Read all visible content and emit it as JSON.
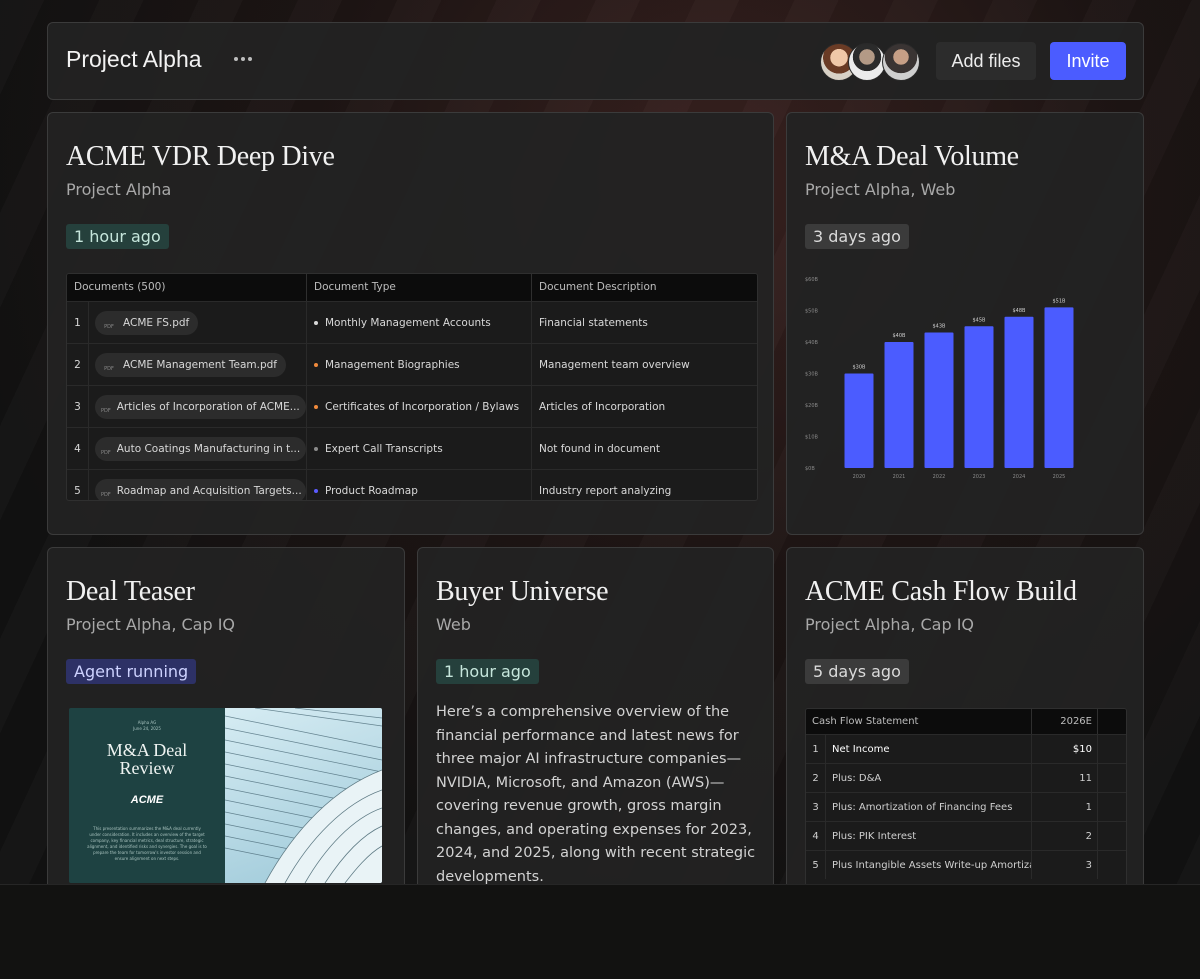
{
  "header": {
    "title": "Project Alpha",
    "add_files_label": "Add files",
    "invite_label": "Invite"
  },
  "cards": {
    "vdr": {
      "title": "ACME VDR Deep Dive",
      "subtitle": "Project Alpha",
      "badge": "1 hour ago",
      "table": {
        "columns": [
          "Documents (500)",
          "Document Type",
          "Document Description"
        ],
        "rows": [
          {
            "num": "1",
            "file": "ACME FS.pdf",
            "type": "Monthly Management Accounts",
            "type_color": "#d9d9d9",
            "desc": "Financial statements"
          },
          {
            "num": "2",
            "file": "ACME Management Team.pdf",
            "type": "Management Biographies",
            "type_color": "#f08a3c",
            "desc": "Management team overview"
          },
          {
            "num": "3",
            "file": "Articles of Incorporation of ACME...",
            "type": "Certificates of Incorporation / Bylaws",
            "type_color": "#f08a3c",
            "desc": "Articles of Incorporation"
          },
          {
            "num": "4",
            "file": "Auto Coatings Manufacturing in t...",
            "type": "Expert Call Transcripts",
            "type_color": "#8a8a8a",
            "desc": "Not found in document"
          },
          {
            "num": "5",
            "file": "Roadmap and Acquisition Targets...",
            "type": "Product Roadmap",
            "type_color": "#5b5bff",
            "desc": "Industry report analyzing"
          }
        ],
        "pdf_label": "PDF"
      }
    },
    "deal_volume": {
      "title": "M&A Deal Volume",
      "subtitle": "Project Alpha, Web",
      "badge": "3 days ago"
    },
    "teaser": {
      "title": "Deal Teaser",
      "subtitle": "Project Alpha, Cap IQ",
      "badge": "Agent running",
      "doc": {
        "meta_line1": "Alpha AG",
        "meta_line2": "June 24, 2025",
        "heading_line1": "M&A Deal",
        "heading_line2": "Review",
        "logo": "ACME",
        "paragraph": "This presentation summarizes the M&A deal currently under consideration. It includes an overview of the target company, key financial metrics, deal structure, strategic alignment, and identified risks and synergies. The goal is to prepare the team for tomorrow's investor session and ensure alignment on next steps."
      }
    },
    "buyer": {
      "title": "Buyer Universe",
      "subtitle": "Web",
      "badge": "1 hour ago",
      "body": "Here’s a comprehensive overview of the financial performance and latest news for three major AI infrastructure companies—NVIDIA, Microsoft, and Amazon (AWS)—covering revenue growth, gross margin changes, and operating expenses for 2023, 2024, and 2025, along with recent strategic developments."
    },
    "cashflow": {
      "title": "ACME Cash Flow Build",
      "subtitle": "Project Alpha, Cap IQ",
      "badge": "5 days ago",
      "table": {
        "header_label": "Cash Flow Statement",
        "header_year": "2026E",
        "rows": [
          {
            "num": "1",
            "label": "Net Income",
            "value": "$10",
            "bold": true
          },
          {
            "num": "2",
            "label": "Plus: D&A",
            "value": "11",
            "bold": false
          },
          {
            "num": "3",
            "label": "Plus: Amortization of Financing Fees",
            "value": "1",
            "bold": false
          },
          {
            "num": "4",
            "label": "Plus: PIK Interest",
            "value": "2",
            "bold": false
          },
          {
            "num": "5",
            "label": "Plus Intangible Assets Write-up Amortizat...",
            "value": "3",
            "bold": false
          }
        ]
      }
    }
  },
  "chart_data": {
    "type": "bar",
    "categories": [
      "2020",
      "2021",
      "2022",
      "2023",
      "2024",
      "2025"
    ],
    "values": [
      30,
      40,
      43,
      45,
      48,
      51
    ],
    "data_labels": [
      "$30B",
      "$40B",
      "$43B",
      "$45B",
      "$48B",
      "$51B"
    ],
    "y_ticks": [
      "$0B",
      "$10B",
      "$20B",
      "$30B",
      "$40B",
      "$50B",
      "$60B"
    ],
    "ylim": [
      0,
      60
    ],
    "bar_color": "#4b5cff",
    "grid": false,
    "title": "",
    "xlabel": "",
    "ylabel": ""
  }
}
